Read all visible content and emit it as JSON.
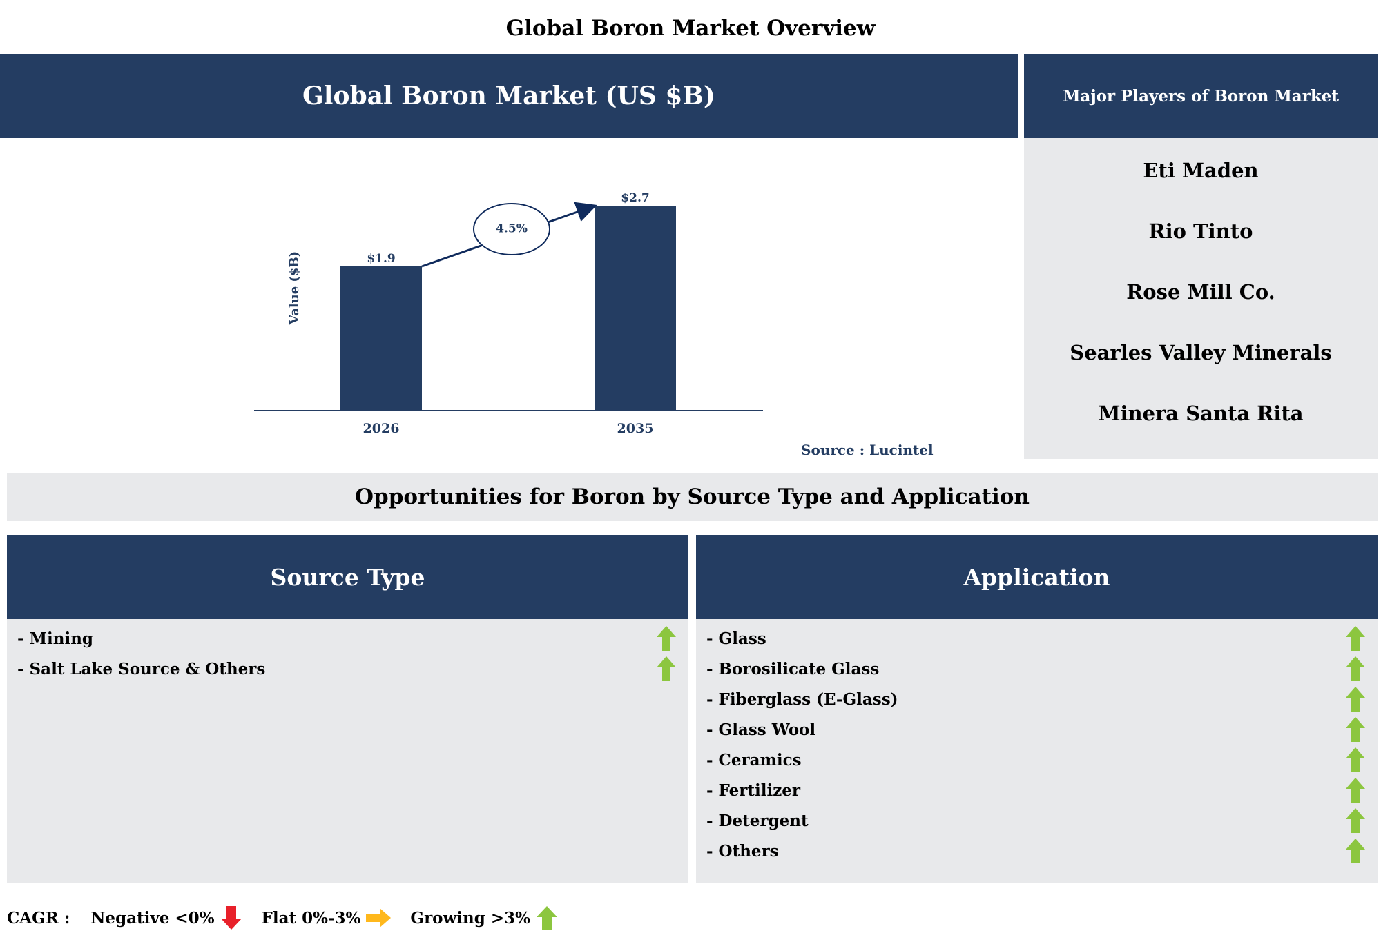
{
  "page_title": "Global Boron Market Overview",
  "market_header": "Global Boron Market (US $B)",
  "players_header": "Major Players of Boron Market",
  "players": [
    "Eti Maden",
    "Rio Tinto",
    "Rose Mill Co.",
    "Searles Valley Minerals",
    "Minera Santa Rita"
  ],
  "source": "Source : Lucintel",
  "opportunities_title": "Opportunities for Boron by Source Type and Application",
  "source_type": {
    "header": "Source Type",
    "items": [
      "- Mining",
      "- Salt Lake Source & Others"
    ],
    "trend": [
      "growing",
      "growing"
    ]
  },
  "application": {
    "header": "Application",
    "items": [
      "- Glass",
      "- Borosilicate Glass",
      "- Fiberglass (E-Glass)",
      "- Glass Wool",
      "- Ceramics",
      "- Fertilizer",
      "- Detergent",
      "- Others"
    ],
    "trend": [
      "growing",
      "growing",
      "growing",
      "growing",
      "growing",
      "growing",
      "growing",
      "growing"
    ]
  },
  "legend": {
    "label": "CAGR :",
    "negative": "Negative <0%",
    "flat": "Flat 0%-3%",
    "growing": "Growing >3%"
  },
  "colors": {
    "navy": "#243d62",
    "panel_grey": "#e8e9eb",
    "growing_green": "#8cc63f",
    "flat_orange": "#ffb81c",
    "negative_red": "#e8202a"
  },
  "chart_data": {
    "type": "bar",
    "categories": [
      "2026",
      "2035"
    ],
    "values": [
      1.9,
      2.7
    ],
    "value_labels": [
      "$1.9",
      "$2.7"
    ],
    "ylabel": "Value ($B)",
    "ylim": [
      0,
      3
    ],
    "cagr_label": "4.5%",
    "grid": false
  }
}
